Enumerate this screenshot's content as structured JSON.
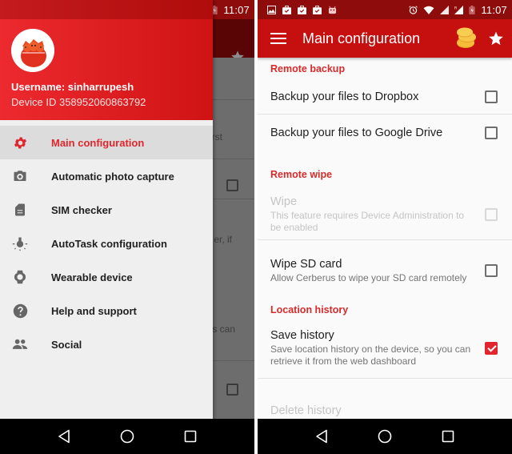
{
  "status_bar": {
    "time": "11:07",
    "notification_icons": [
      "image-icon",
      "briefcase-check-icon",
      "briefcase-check-icon",
      "briefcase-check-icon",
      "android-icon"
    ],
    "system_icons": [
      "alarm-icon",
      "wifi-icon",
      "signal-icon",
      "roaming-signal-icon",
      "battery-charging-icon"
    ],
    "roaming_label": "R"
  },
  "left_screen": {
    "drawer": {
      "username": "Username: sinharrupesh",
      "device_id": "Device ID 358952060863792",
      "items": [
        {
          "label": "Main configuration",
          "icon": "gear-icon",
          "active": true
        },
        {
          "label": "Automatic photo capture",
          "icon": "camera-icon",
          "active": false
        },
        {
          "label": "SIM checker",
          "icon": "sim-card-icon",
          "active": false
        },
        {
          "label": "AutoTask configuration",
          "icon": "lightbulb-icon",
          "active": false
        },
        {
          "label": "Wearable device",
          "icon": "watch-icon",
          "active": false
        },
        {
          "label": "Help and support",
          "icon": "help-icon",
          "active": false
        },
        {
          "label": "Social",
          "icon": "people-icon",
          "active": false
        }
      ]
    },
    "background_fragments": [
      "rst",
      "er, if",
      "s can"
    ]
  },
  "right_screen": {
    "app_bar": {
      "title": "Main configuration",
      "menu_icon": "hamburger-menu-icon",
      "coins_icon": "coins-icon",
      "star_icon": "star-icon"
    },
    "sections": [
      {
        "header": "Remote backup",
        "prefs": [
          {
            "title": "Backup your files to Dropbox",
            "summary": "",
            "checked": false,
            "enabled": true
          },
          {
            "title": "Backup your files to Google Drive",
            "summary": "",
            "checked": false,
            "enabled": true
          }
        ]
      },
      {
        "header": "Remote wipe",
        "prefs": [
          {
            "title": "Wipe",
            "summary": "This feature requires Device Administration to be enabled",
            "checked": false,
            "enabled": false
          },
          {
            "title": "Wipe SD card",
            "summary": "Allow Cerberus to wipe your SD card remotely",
            "checked": false,
            "enabled": true
          }
        ]
      },
      {
        "header": "Location history",
        "prefs": [
          {
            "title": "Save history",
            "summary": "Save location history on the device, so you can retrieve it from the web dashboard",
            "checked": true,
            "enabled": true
          },
          {
            "title": "Delete history",
            "summary": "",
            "checked": false,
            "enabled": false
          }
        ]
      }
    ]
  },
  "nav_bar": {
    "buttons": [
      "back-icon",
      "home-icon",
      "recents-icon"
    ]
  },
  "colors": {
    "primary": "#c61010",
    "primary_dark": "#8f0c0c",
    "accent": "#e2242f"
  }
}
